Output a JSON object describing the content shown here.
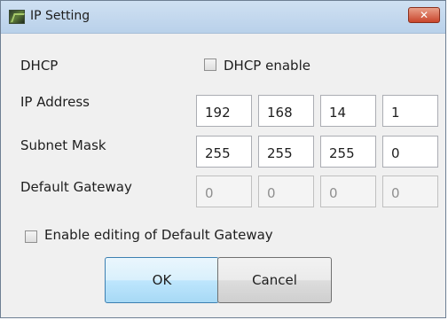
{
  "window": {
    "title": "IP Setting",
    "close_glyph": "✕"
  },
  "dhcp": {
    "label": "DHCP",
    "checkbox_label": "DHCP enable",
    "checked": false
  },
  "ip_address": {
    "label": "IP Address",
    "octets": [
      "192",
      "168",
      "14",
      "1"
    ]
  },
  "subnet_mask": {
    "label": "Subnet Mask",
    "octets": [
      "255",
      "255",
      "255",
      "0"
    ]
  },
  "default_gateway": {
    "label": "Default Gateway",
    "octets": [
      "0",
      "0",
      "0",
      "0"
    ],
    "enabled": false
  },
  "gateway_edit": {
    "checkbox_label": "Enable editing of Default Gateway",
    "checked": false
  },
  "buttons": {
    "ok_label": "OK",
    "cancel_label": "Cancel"
  },
  "icons": {
    "app": "app-icon",
    "close": "close-icon"
  }
}
